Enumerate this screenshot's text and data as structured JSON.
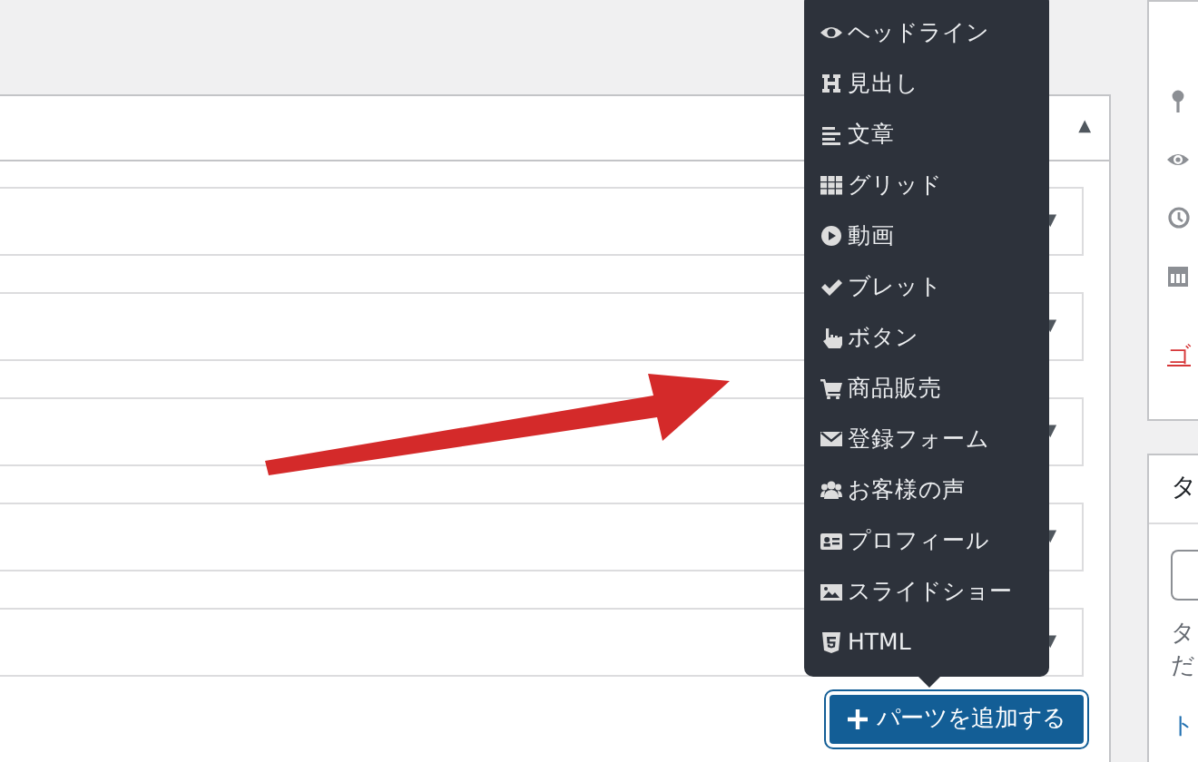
{
  "editor": {
    "collapse_toggle": "▲",
    "rows": [
      {
        "toggle": "▼"
      },
      {
        "toggle": "▼"
      },
      {
        "toggle": "▼"
      },
      {
        "toggle": "▼"
      },
      {
        "toggle": "▼"
      }
    ],
    "add_button": {
      "label": "パーツを追加する"
    }
  },
  "parts_menu": [
    {
      "kind": "headline",
      "label": "ヘッドライン"
    },
    {
      "kind": "heading",
      "label": "見出し"
    },
    {
      "kind": "text",
      "label": "文章"
    },
    {
      "kind": "grid",
      "label": "グリッド"
    },
    {
      "kind": "video",
      "label": "動画"
    },
    {
      "kind": "bullet",
      "label": "ブレット"
    },
    {
      "kind": "button",
      "label": "ボタン"
    },
    {
      "kind": "product",
      "label": "商品販売"
    },
    {
      "kind": "form",
      "label": "登録フォーム"
    },
    {
      "kind": "testimonial",
      "label": "お客様の声"
    },
    {
      "kind": "profile",
      "label": "プロフィール"
    },
    {
      "kind": "slideshow",
      "label": "スライドショー"
    },
    {
      "kind": "html",
      "label": "HTML"
    }
  ],
  "sidebar": {
    "publish_panel": {
      "trash_link": "ゴ"
    },
    "second_panel": {
      "heading": "タ",
      "help_lines": [
        "タ",
        "だ"
      ],
      "link": "ト"
    }
  }
}
